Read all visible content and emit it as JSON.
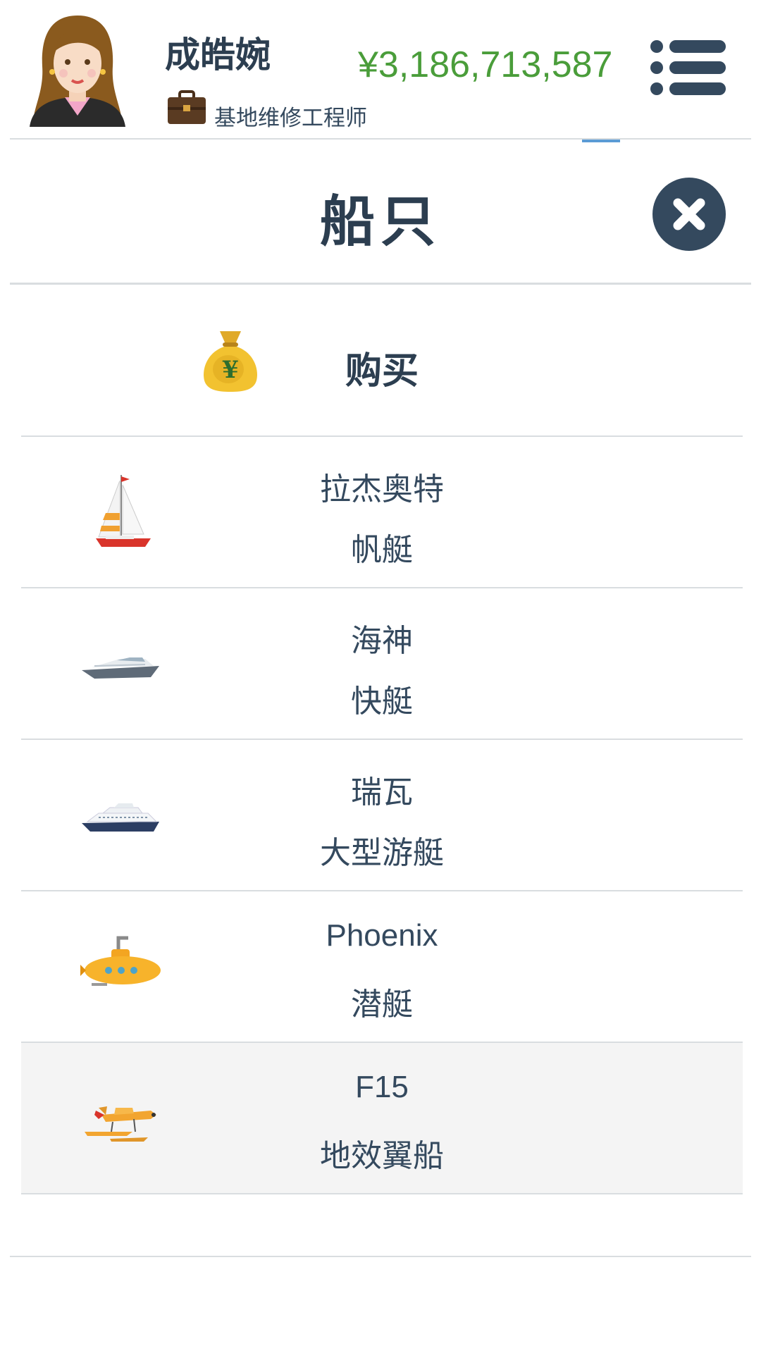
{
  "header": {
    "name": "成皓婉",
    "job_title": "基地维修工程师",
    "money": "¥3,186,713,587",
    "money_color": "#4a9d3a",
    "avatar_icon": "avatar-woman-icon",
    "job_icon": "briefcase-icon",
    "menu_icon": "list-menu-icon"
  },
  "page": {
    "title": "船只",
    "close_icon": "close-icon"
  },
  "buy": {
    "label": "购买",
    "icon": "money-bag-icon"
  },
  "boats": [
    {
      "name": "拉杰奥特",
      "type": "帆艇",
      "icon": "sailboat-icon"
    },
    {
      "name": "海神",
      "type": "快艇",
      "icon": "speedboat-icon"
    },
    {
      "name": "瑞瓦",
      "type": "大型游艇",
      "icon": "yacht-icon"
    },
    {
      "name": "Phoenix",
      "type": "潜艇",
      "icon": "submarine-icon"
    },
    {
      "name": "F15",
      "type": "地效翼船",
      "icon": "seaplane-icon",
      "selected": true
    }
  ]
}
